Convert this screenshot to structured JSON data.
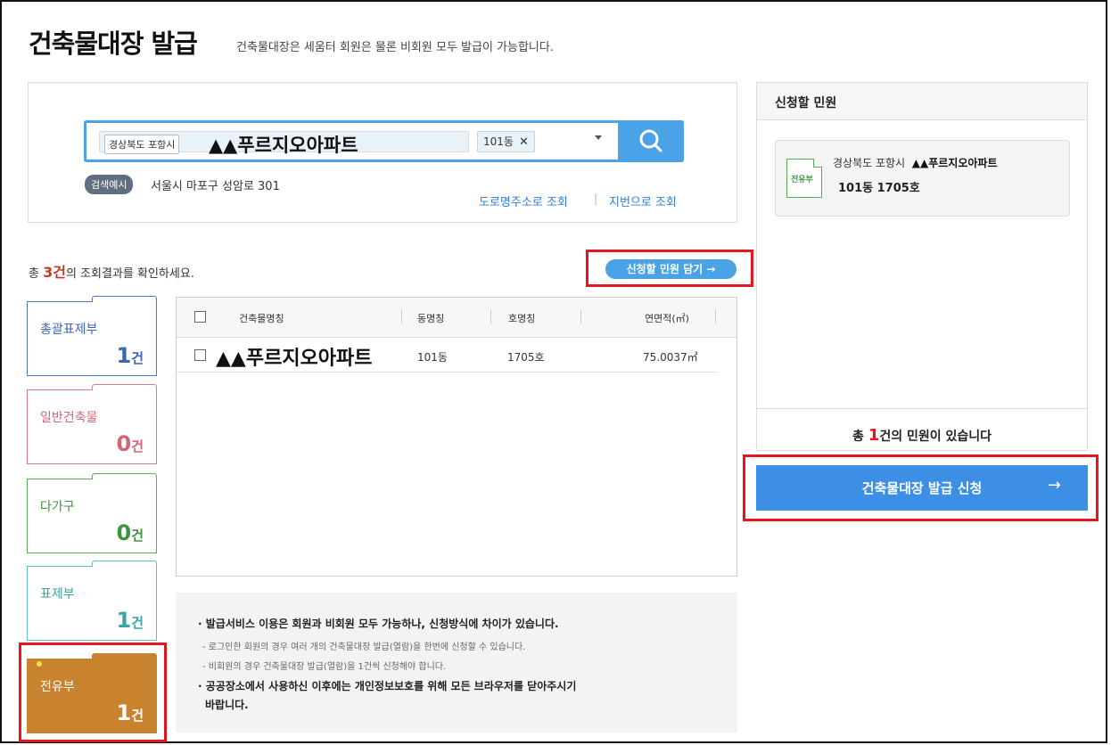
{
  "header": {
    "title": "건축물대장 발급",
    "subtitle": "건축물대장은 세움터 회원은 물론 비회원 모두 발급이 가능합니다."
  },
  "search": {
    "region": "경상북도 포항시",
    "building": "▲▲푸르지오아파트",
    "dong_chip": "101동",
    "chip_remove": "✕",
    "example_badge": "검색예시",
    "example_text": "서울시 마포구 성암로 301",
    "road_link": "도로명주소로 조회",
    "link_sep": "|",
    "lot_link": "지번으로 조회"
  },
  "results": {
    "prefix": "총 ",
    "count": "3건",
    "suffix": "의 조회결과를 확인하세요.",
    "add_button": "신청할 민원 담기 →"
  },
  "categories": [
    {
      "label": "총괄표제부",
      "count": "1",
      "unit": "건"
    },
    {
      "label": "일반건축물",
      "count": "0",
      "unit": "건"
    },
    {
      "label": "다가구",
      "count": "0",
      "unit": "건"
    },
    {
      "label": "표제부",
      "count": "1",
      "unit": "건"
    },
    {
      "label": "전유부",
      "count": "1",
      "unit": "건"
    }
  ],
  "table": {
    "headers": [
      "건축물명칭",
      "동명칭",
      "호명칭",
      "연면적(㎡)"
    ],
    "rows": [
      {
        "name": "▲▲푸르지오아파트",
        "dong": "101동",
        "ho": "1705호",
        "area": "75.0037㎡"
      }
    ]
  },
  "notice": {
    "line1": "· 발급서비스 이용은 회원과 비회원 모두 가능하나, 신청방식에 차이가 있습니다.",
    "line2": "- 로그인한 회원의 경우 여러 개의 건축물대장 발급(열람)을 한번에 신청할 수 있습니다.",
    "line3": "- 비회원의 경우 건축물대장 발급(열람)을 1건씩 신청해야 합니다.",
    "line4": "· 공공장소에서 사용하신 이후에는 개인정보보호를 위해 모든 브라우저를 닫아주시기",
    "line5": "바랍니다."
  },
  "request_panel": {
    "title": "신청할 민원",
    "card": {
      "icon_label": "전유부",
      "region": "경상북도 포항시",
      "building": "▲▲푸르지오아파트",
      "unit": "101동 1705호"
    },
    "total_prefix": "총 ",
    "total_count": "1",
    "total_suffix": "건의 민원이 있습니다",
    "apply_button": "건축물대장 발급 신청",
    "apply_arrow": "→"
  },
  "colors": {
    "accent_blue": "#4aa3e6",
    "apply_blue": "#3d8fe6",
    "highlight_red": "#e4161f",
    "selected_category": "#c9822d"
  }
}
